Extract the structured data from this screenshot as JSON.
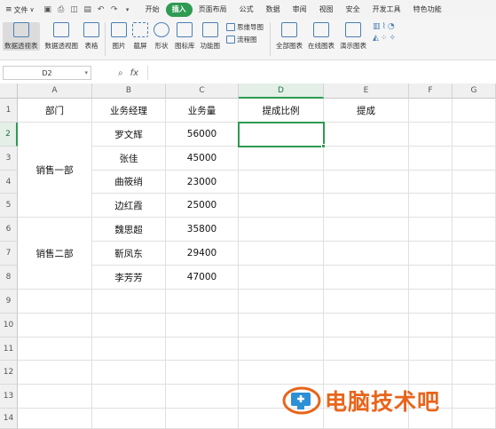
{
  "menubar": {
    "file_label": "文件",
    "file_arrow": "∨",
    "quick_icons": [
      "save-icon",
      "print-icon",
      "preview-icon",
      "export-icon",
      "undo-icon",
      "redo-icon",
      "more-icon"
    ],
    "tabs": [
      {
        "label": "开始",
        "active": false
      },
      {
        "label": "插入",
        "active": true
      },
      {
        "label": "页面布局",
        "active": false
      },
      {
        "label": "公式",
        "active": false
      },
      {
        "label": "数据",
        "active": false
      },
      {
        "label": "审阅",
        "active": false
      },
      {
        "label": "视图",
        "active": false
      },
      {
        "label": "安全",
        "active": false
      },
      {
        "label": "开发工具",
        "active": false
      },
      {
        "label": "特色功能",
        "active": false
      }
    ]
  },
  "ribbon": {
    "pivot_table": "数据透视表",
    "pivot_chart": "数据透视图",
    "table": "表格",
    "picture": "图片",
    "screenshot": "截屏",
    "shape": "形状",
    "icon_lib": "图标库",
    "func_chart": "功能图",
    "mindmap": "思维导图",
    "flowchart": "流程图",
    "all_charts": "全部图表",
    "online_charts": "在线图表",
    "demo_charts": "演示图表"
  },
  "formula_bar": {
    "cell_ref": "D2",
    "fx": "fx",
    "content": ""
  },
  "sheet": {
    "columns": [
      "A",
      "B",
      "C",
      "D",
      "E",
      "F",
      "G"
    ],
    "rows": [
      "1",
      "2",
      "3",
      "4",
      "5",
      "6",
      "7",
      "8",
      "9",
      "10",
      "11",
      "12",
      "13",
      "14"
    ],
    "headers": {
      "a": "部门",
      "b": "业务经理",
      "c": "业务量",
      "d": "提成比例",
      "e": "提成"
    },
    "dept1": "销售一部",
    "dept2": "销售二部",
    "records": [
      {
        "name": "罗文辉",
        "volume": "56000"
      },
      {
        "name": "张佳",
        "volume": "45000"
      },
      {
        "name": "曲筱绡",
        "volume": "23000"
      },
      {
        "name": "边红霞",
        "volume": "25000"
      },
      {
        "name": "魏思超",
        "volume": "35800"
      },
      {
        "name": "靳凤东",
        "volume": "29400"
      },
      {
        "name": "李芳芳",
        "volume": "47000"
      }
    ],
    "selected_cell": "D2"
  },
  "watermark": {
    "text": "电脑技术吧"
  },
  "colors": {
    "accent": "#2e9a52",
    "watermark": "#e8651b"
  }
}
